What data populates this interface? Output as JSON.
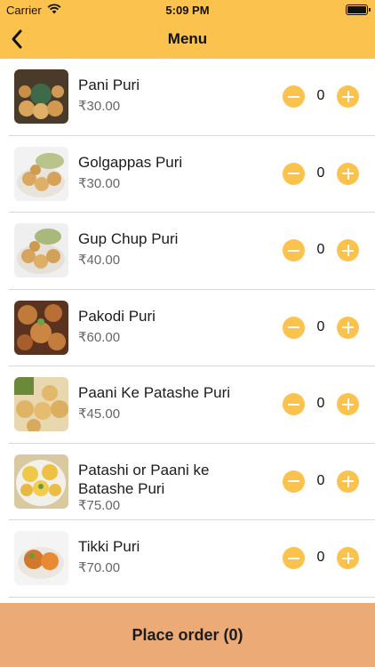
{
  "status": {
    "carrier": "Carrier",
    "time": "5:09 PM"
  },
  "nav": {
    "title": "Menu",
    "back_icon": "chevron-left-icon"
  },
  "items": [
    {
      "name": "Pani Puri",
      "price": "₹30.00",
      "qty": "0"
    },
    {
      "name": "Golgappas Puri",
      "price": "₹30.00",
      "qty": "0"
    },
    {
      "name": "Gup Chup Puri",
      "price": "₹40.00",
      "qty": "0"
    },
    {
      "name": "Pakodi Puri",
      "price": "₹60.00",
      "qty": "0"
    },
    {
      "name": "Paani Ke Patashe Puri",
      "price": "₹45.00",
      "qty": "0"
    },
    {
      "name": "Patashi or Paani ke Batashe Puri",
      "price": "₹75.00",
      "qty": "0"
    },
    {
      "name": "Tikki Puri",
      "price": "₹70.00",
      "qty": "0"
    }
  ],
  "order": {
    "label": "Place order (0)"
  },
  "colors": {
    "accent": "#fcc24e",
    "order_bar": "#ecaa76"
  }
}
